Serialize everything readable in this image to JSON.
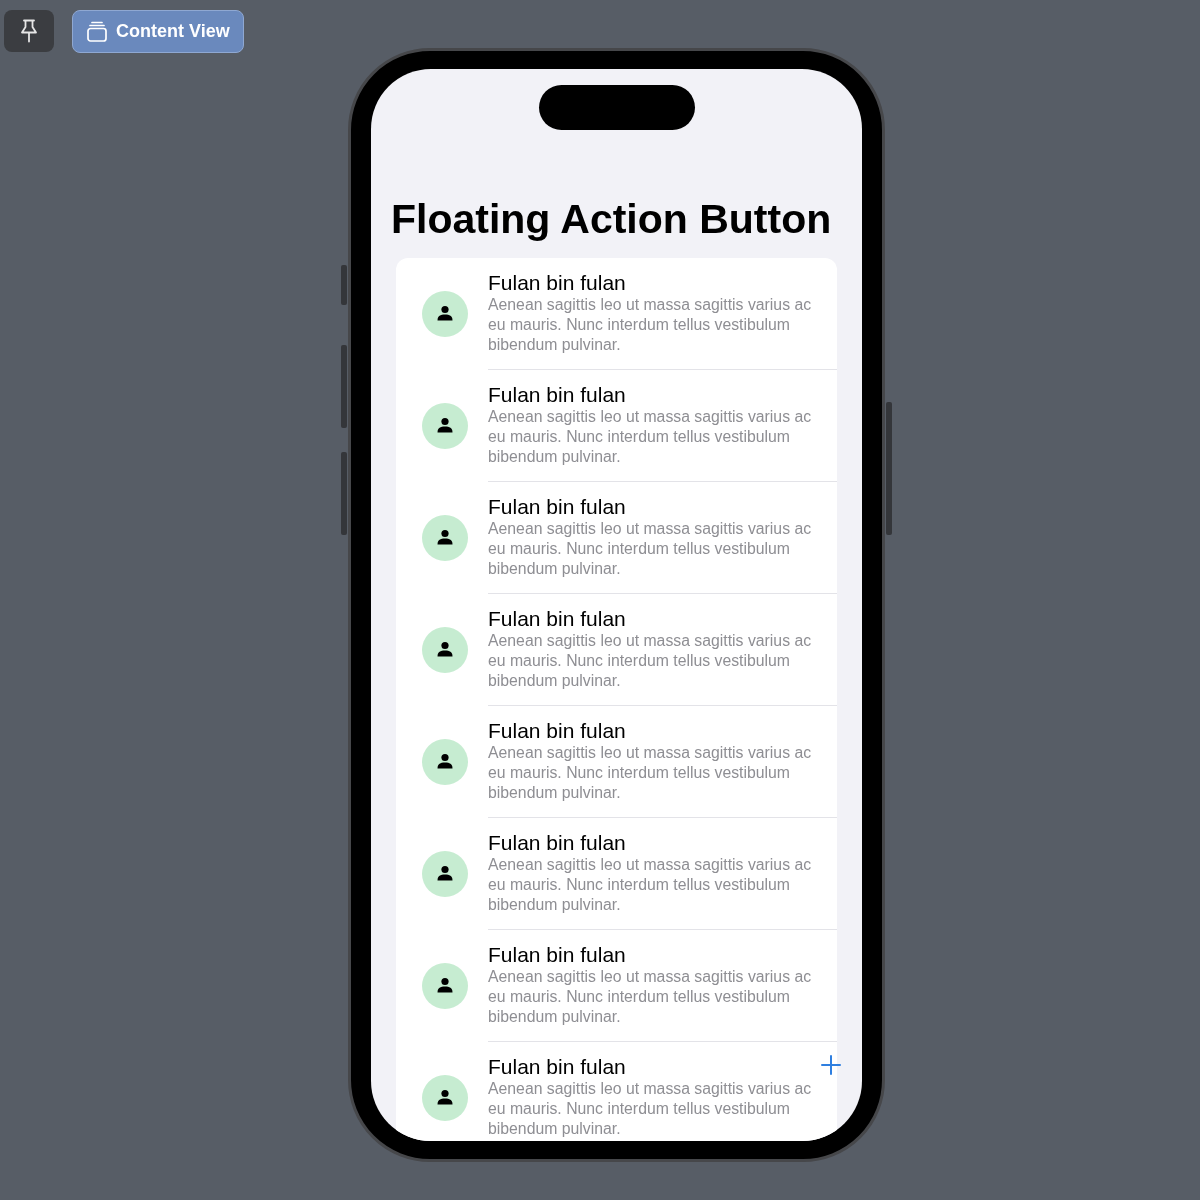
{
  "toolbar": {
    "preview_tab": {
      "label": "Content View",
      "selected": true
    }
  },
  "screen": {
    "title": "Floating Action Button",
    "contacts": [
      {
        "name": "Fulan bin fulan",
        "description": "Aenean sagittis leo ut massa sagittis varius ac eu mauris. Nunc interdum tellus vestibulum bibendum pulvinar."
      },
      {
        "name": "Fulan bin fulan",
        "description": "Aenean sagittis leo ut massa sagittis varius ac eu mauris. Nunc interdum tellus vestibulum bibendum pulvinar."
      },
      {
        "name": "Fulan bin fulan",
        "description": "Aenean sagittis leo ut massa sagittis varius ac eu mauris. Nunc interdum tellus vestibulum bibendum pulvinar."
      },
      {
        "name": "Fulan bin fulan",
        "description": "Aenean sagittis leo ut massa sagittis varius ac eu mauris. Nunc interdum tellus vestibulum bibendum pulvinar."
      },
      {
        "name": "Fulan bin fulan",
        "description": "Aenean sagittis leo ut massa sagittis varius ac eu mauris. Nunc interdum tellus vestibulum bibendum pulvinar."
      },
      {
        "name": "Fulan bin fulan",
        "description": "Aenean sagittis leo ut massa sagittis varius ac eu mauris. Nunc interdum tellus vestibulum bibendum pulvinar."
      },
      {
        "name": "Fulan bin fulan",
        "description": "Aenean sagittis leo ut massa sagittis varius ac eu mauris. Nunc interdum tellus vestibulum bibendum pulvinar."
      },
      {
        "name": "Fulan bin fulan",
        "description": "Aenean sagittis leo ut massa sagittis varius ac eu mauris. Nunc interdum tellus vestibulum bibendum pulvinar."
      }
    ]
  }
}
